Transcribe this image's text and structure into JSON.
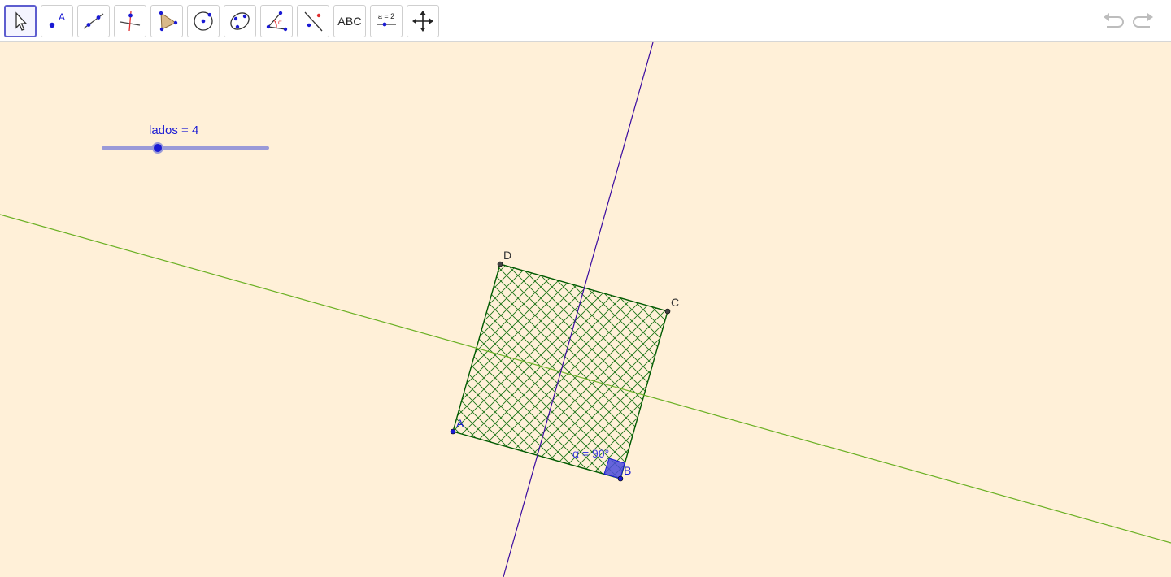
{
  "toolbar": {
    "tools": [
      {
        "name": "move-tool",
        "label": ""
      },
      {
        "name": "point-tool",
        "label": "A"
      },
      {
        "name": "line-tool",
        "label": ""
      },
      {
        "name": "perpendicular-line-tool",
        "label": ""
      },
      {
        "name": "polygon-tool",
        "label": ""
      },
      {
        "name": "circle-tool",
        "label": ""
      },
      {
        "name": "conic-tool",
        "label": ""
      },
      {
        "name": "angle-tool",
        "label": "α"
      },
      {
        "name": "reflect-tool",
        "label": ""
      },
      {
        "name": "text-tool",
        "label": "ABC"
      },
      {
        "name": "slider-tool",
        "label": "a = 2"
      },
      {
        "name": "move-graphics-view-tool",
        "label": ""
      }
    ],
    "selected_tool": "move-tool"
  },
  "canvas": {
    "background": "#fff0d8",
    "slider": {
      "label": "lados = 4",
      "value": 4,
      "min": 0,
      "max": 12,
      "fraction": 0.33
    },
    "points": {
      "A": "A",
      "B": "B",
      "C": "C",
      "D": "D"
    },
    "angle_label": "α = 90°",
    "colors": {
      "square_fill": "#006400",
      "square_stroke": "#005a00",
      "green_line": "#6ab023",
      "purple_line": "#3a0aa0",
      "point_blue": "#1a1ad4",
      "point_dark": "#333333",
      "angle_fill": "#4b4bdc"
    }
  }
}
